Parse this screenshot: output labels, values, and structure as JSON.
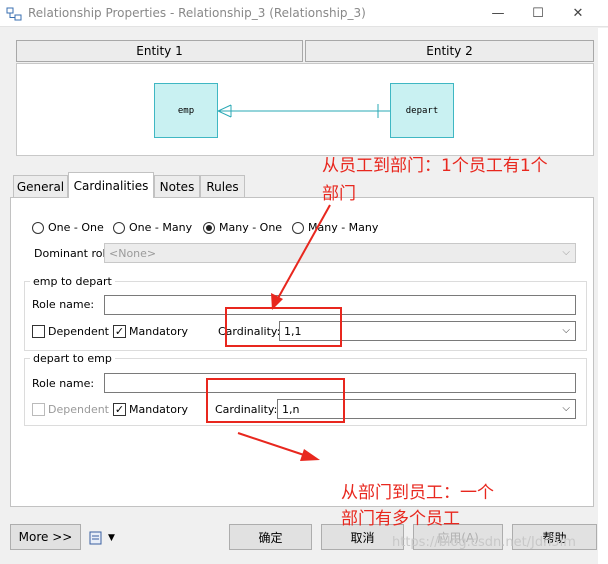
{
  "window": {
    "title": "Relationship Properties - Relationship_3 (Relationship_3)",
    "minimize_icon": "minimize-icon",
    "maximize_icon": "maximize-icon",
    "close_icon": "close-icon"
  },
  "entities": {
    "entity1_label": "Entity 1",
    "entity2_label": "Entity 2",
    "entity1_name": "emp",
    "entity2_name": "depart"
  },
  "tabs": [
    "General",
    "Cardinalities",
    "Notes",
    "Rules"
  ],
  "cardinality_options": [
    "One - One",
    "One - Many",
    "Many - One",
    "Many - Many"
  ],
  "selected_option": "Many - One",
  "dominant_role": {
    "label": "Dominant role:",
    "value": "<None>"
  },
  "group1": {
    "title": "emp to depart",
    "role_label": "Role name:",
    "role_value": "",
    "dependent_label": "Dependent",
    "dependent_checked": false,
    "mandatory_label": "Mandatory",
    "mandatory_checked": true,
    "cardinality_label": "Cardinality:",
    "cardinality_value": "1,1"
  },
  "group2": {
    "title": "depart to emp",
    "role_label": "Role name:",
    "role_value": "",
    "dependent_label": "Dependent",
    "dependent_checked": false,
    "mandatory_label": "Mandatory",
    "mandatory_checked": true,
    "cardinality_label": "Cardinality:",
    "cardinality_value": "1,n"
  },
  "buttons": {
    "more": "More >>",
    "ok": "确定",
    "cancel": "取消",
    "apply": "应用(A)",
    "help": "帮助"
  },
  "annotations": {
    "top_line1": "从员工到部门：1个员工有1个",
    "top_line2": "部门",
    "bottom_line1": "从部门到员工：一个",
    "bottom_line2": "部门有多个员工"
  },
  "watermark": "https://blog.csdn.net/Jdn5lm",
  "colors": {
    "annotation": "#e8271e",
    "entity_fill": "#c9f1f2",
    "entity_border": "#3fb7c3",
    "connector": "#2aa8b5"
  }
}
